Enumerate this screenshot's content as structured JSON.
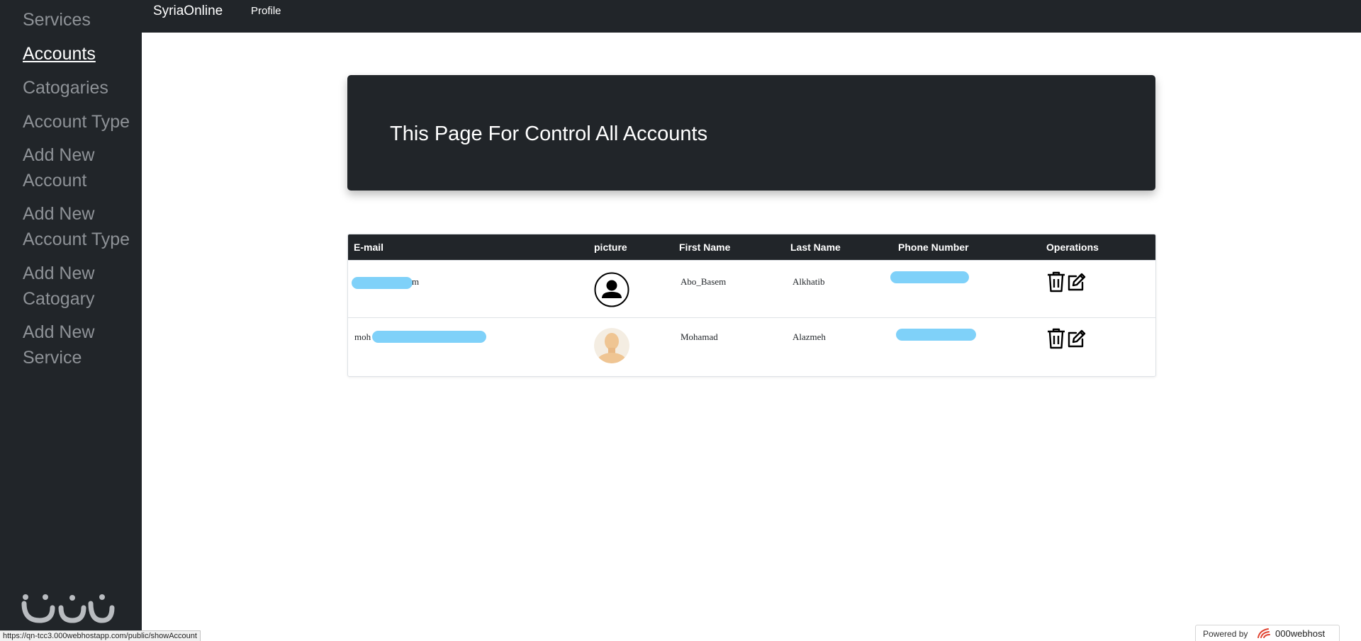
{
  "sidebar": {
    "items": [
      {
        "label": "Services"
      },
      {
        "label": "Accounts"
      },
      {
        "label": "Catogaries"
      },
      {
        "label": "Account Type"
      },
      {
        "label": "Add New Account"
      },
      {
        "label": "Add New Account Type"
      },
      {
        "label": "Add New Catogary"
      },
      {
        "label": "Add New Service"
      }
    ]
  },
  "navbar": {
    "brand": "SyriaOnline",
    "profile": "Profile"
  },
  "hero": {
    "title": "This Page For Control All Accounts"
  },
  "table": {
    "headers": [
      "E-mail",
      "picture",
      "First Name",
      "Last Name",
      "Phone Number",
      "Operations"
    ],
    "rows": [
      {
        "email_visible": "m",
        "first_name": "Abo_Basem",
        "last_name": "Alkhatib",
        "picture_icon": "person-icon"
      },
      {
        "email_visible": "moh",
        "first_name": "Mohamad",
        "last_name": "Alazmeh",
        "picture_icon": "face-photo"
      }
    ],
    "operation_icons": [
      "trash-icon",
      "edit-icon"
    ]
  },
  "statusbar": {
    "url": "https://qn-tcc3.000webhostapp.com/public/showAccount"
  },
  "powered": {
    "label": "Powered by",
    "brand": "000webhost"
  },
  "colors": {
    "dark": "#212529",
    "redacted": "#7fd1f9",
    "muted": "#8e9297"
  }
}
